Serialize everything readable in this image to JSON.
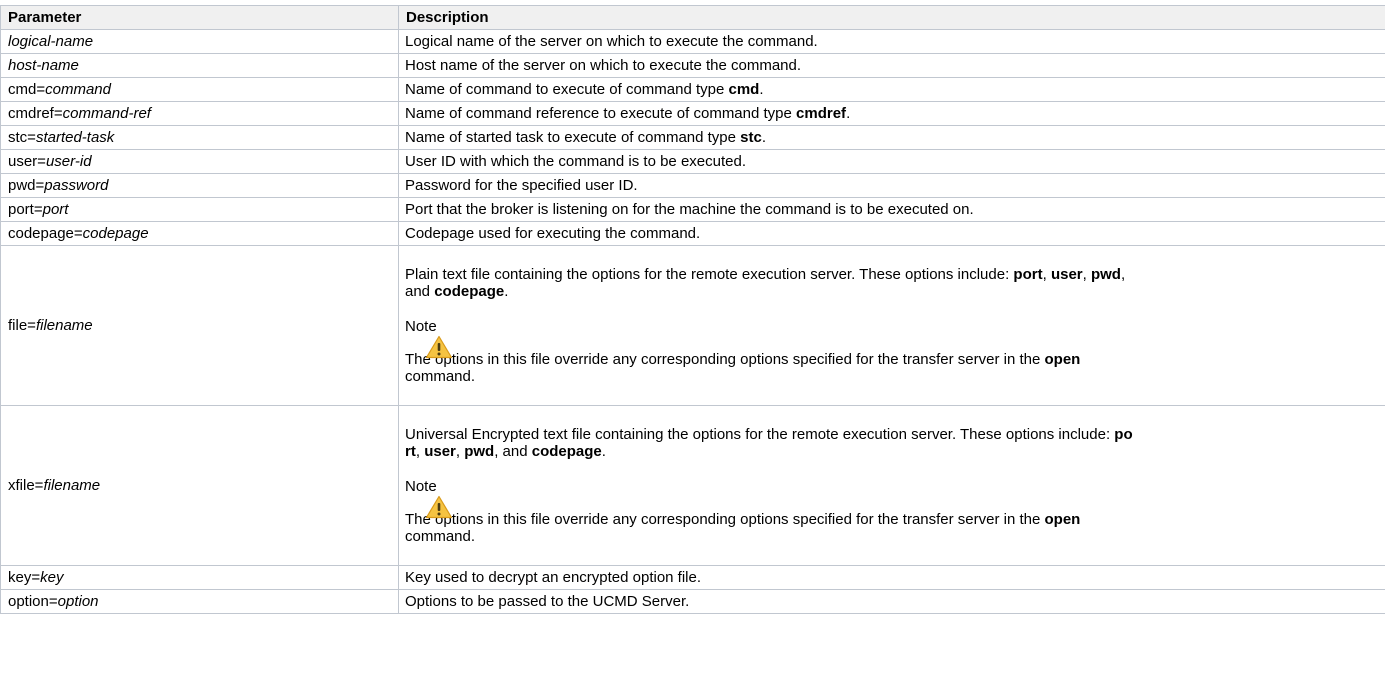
{
  "header": {
    "parameter": "Parameter",
    "description": "Description"
  },
  "rows": [
    {
      "param_pre": "",
      "param_em": "logical-name",
      "desc": "Logical name of the server on which to execute the command."
    },
    {
      "param_pre": "",
      "param_em": "host-name",
      "desc": "Host name of the server on which to execute the command."
    },
    {
      "param_pre": "cmd=",
      "param_em": "command",
      "desc_pre": "Name of command to execute of command type ",
      "desc_bold": "cmd",
      "desc_post": "."
    },
    {
      "param_pre": "cmdref=",
      "param_em": "command-ref",
      "desc_pre": "Name of command reference to execute of command type ",
      "desc_bold": "cmdref",
      "desc_post": "."
    },
    {
      "param_pre": "stc=",
      "param_em": "started-task",
      "desc_pre": "Name of started task to execute of command type ",
      "desc_bold": "stc",
      "desc_post": "."
    },
    {
      "param_pre": "user=",
      "param_em": "user-id",
      "desc": "User ID with which the command is to be executed."
    },
    {
      "param_pre": "pwd=",
      "param_em": "password",
      "desc": "Password for the specified user ID."
    },
    {
      "param_pre": "port=",
      "param_em": "port",
      "desc": "Port that the broker is listening on for the machine the command is to be executed on."
    },
    {
      "param_pre": "codepage=",
      "param_em": "codepage",
      "desc": "Codepage used for executing the command."
    }
  ],
  "file_row": {
    "param_pre": "file=",
    "param_em": "filename",
    "line1": "Plain text file containing the options for the remote execution server. These options include: ",
    "opt1": "port",
    "sep1": ", ",
    "opt2": "user",
    "sep2": ", ",
    "opt3": "pwd",
    "sep3": ",",
    "line2_pre": "and ",
    "opt4": "codepage",
    "line2_post": ".",
    "note": "Note",
    "note_pre": "The options in this file override any corresponding options specified for the transfer server in the ",
    "note_bold": "open",
    "note_post": "command."
  },
  "xfile_row": {
    "param_pre": "xfile=",
    "param_em": "filename",
    "line1": "Universal Encrypted text file containing the options for the remote execution server. These options include: ",
    "opt1a": "po",
    "opt1b": "rt",
    "sep1": ", ",
    "opt2": "user",
    "sep2": ", ",
    "opt3": "pwd",
    "sep3": ", and ",
    "opt4": "codepage",
    "post": ".",
    "note": "Note",
    "note_pre": "The options in this file override any corresponding options specified for the transfer server in the ",
    "note_bold": "open",
    "note_post": "command."
  },
  "tail_rows": [
    {
      "param_pre": "key=",
      "param_em": "key",
      "desc": "Key used to decrypt an encrypted option file."
    },
    {
      "param_pre": "option=",
      "param_em": "option",
      "desc": "Options to be passed to the UCMD Server."
    }
  ],
  "icons": {
    "warning": "warning-icon"
  },
  "colors": {
    "border": "#c1c7d0",
    "header_bg": "#f0f0f0",
    "warning_fill": "#f5c342"
  }
}
